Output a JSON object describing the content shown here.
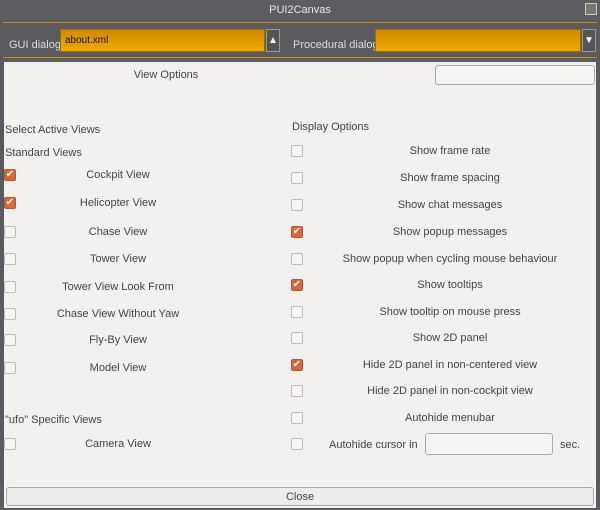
{
  "window": {
    "title": "PUI2Canvas"
  },
  "toolbar": {
    "gui_label": "GUI dialog:",
    "gui_value": "about.xml",
    "proc_label": "Procedural dialog:",
    "proc_value": ""
  },
  "panel": {
    "title": "View Options",
    "search_value": "",
    "close_label": "Close"
  },
  "left": {
    "heading": "Select Active Views",
    "standard_heading": "Standard Views",
    "ufo_heading": "\"ufo\" Specific Views",
    "items": [
      {
        "label": "Cockpit View",
        "checked": true
      },
      {
        "label": "Helicopter View",
        "checked": true
      },
      {
        "label": "Chase View",
        "checked": false
      },
      {
        "label": "Tower View",
        "checked": false
      },
      {
        "label": "Tower View Look From",
        "checked": false
      },
      {
        "label": "Chase View Without Yaw",
        "checked": false
      },
      {
        "label": "Fly-By View",
        "checked": false
      },
      {
        "label": "Model View",
        "checked": false
      }
    ],
    "ufo_items": [
      {
        "label": "Camera View",
        "checked": false
      }
    ]
  },
  "right": {
    "heading": "Display Options",
    "items": [
      {
        "label": "Show frame rate",
        "checked": false
      },
      {
        "label": "Show frame spacing",
        "checked": false
      },
      {
        "label": "Show chat messages",
        "checked": false
      },
      {
        "label": "Show popup messages",
        "checked": true
      },
      {
        "label": "Show popup when cycling mouse behaviour",
        "checked": false
      },
      {
        "label": "Show tooltips",
        "checked": true
      },
      {
        "label": "Show tooltip on mouse press",
        "checked": false
      },
      {
        "label": "Show 2D panel",
        "checked": false
      },
      {
        "label": "Hide 2D panel in non-centered view",
        "checked": true
      },
      {
        "label": "Hide 2D panel in non-cockpit view",
        "checked": false
      },
      {
        "label": "Autohide menubar",
        "checked": false
      }
    ],
    "autohide_cursor": {
      "label": "Autohide cursor in",
      "value": "",
      "unit": "sec.",
      "checked": false
    }
  },
  "colors": {
    "accent": "#f0a800",
    "check": "#d9673d"
  }
}
